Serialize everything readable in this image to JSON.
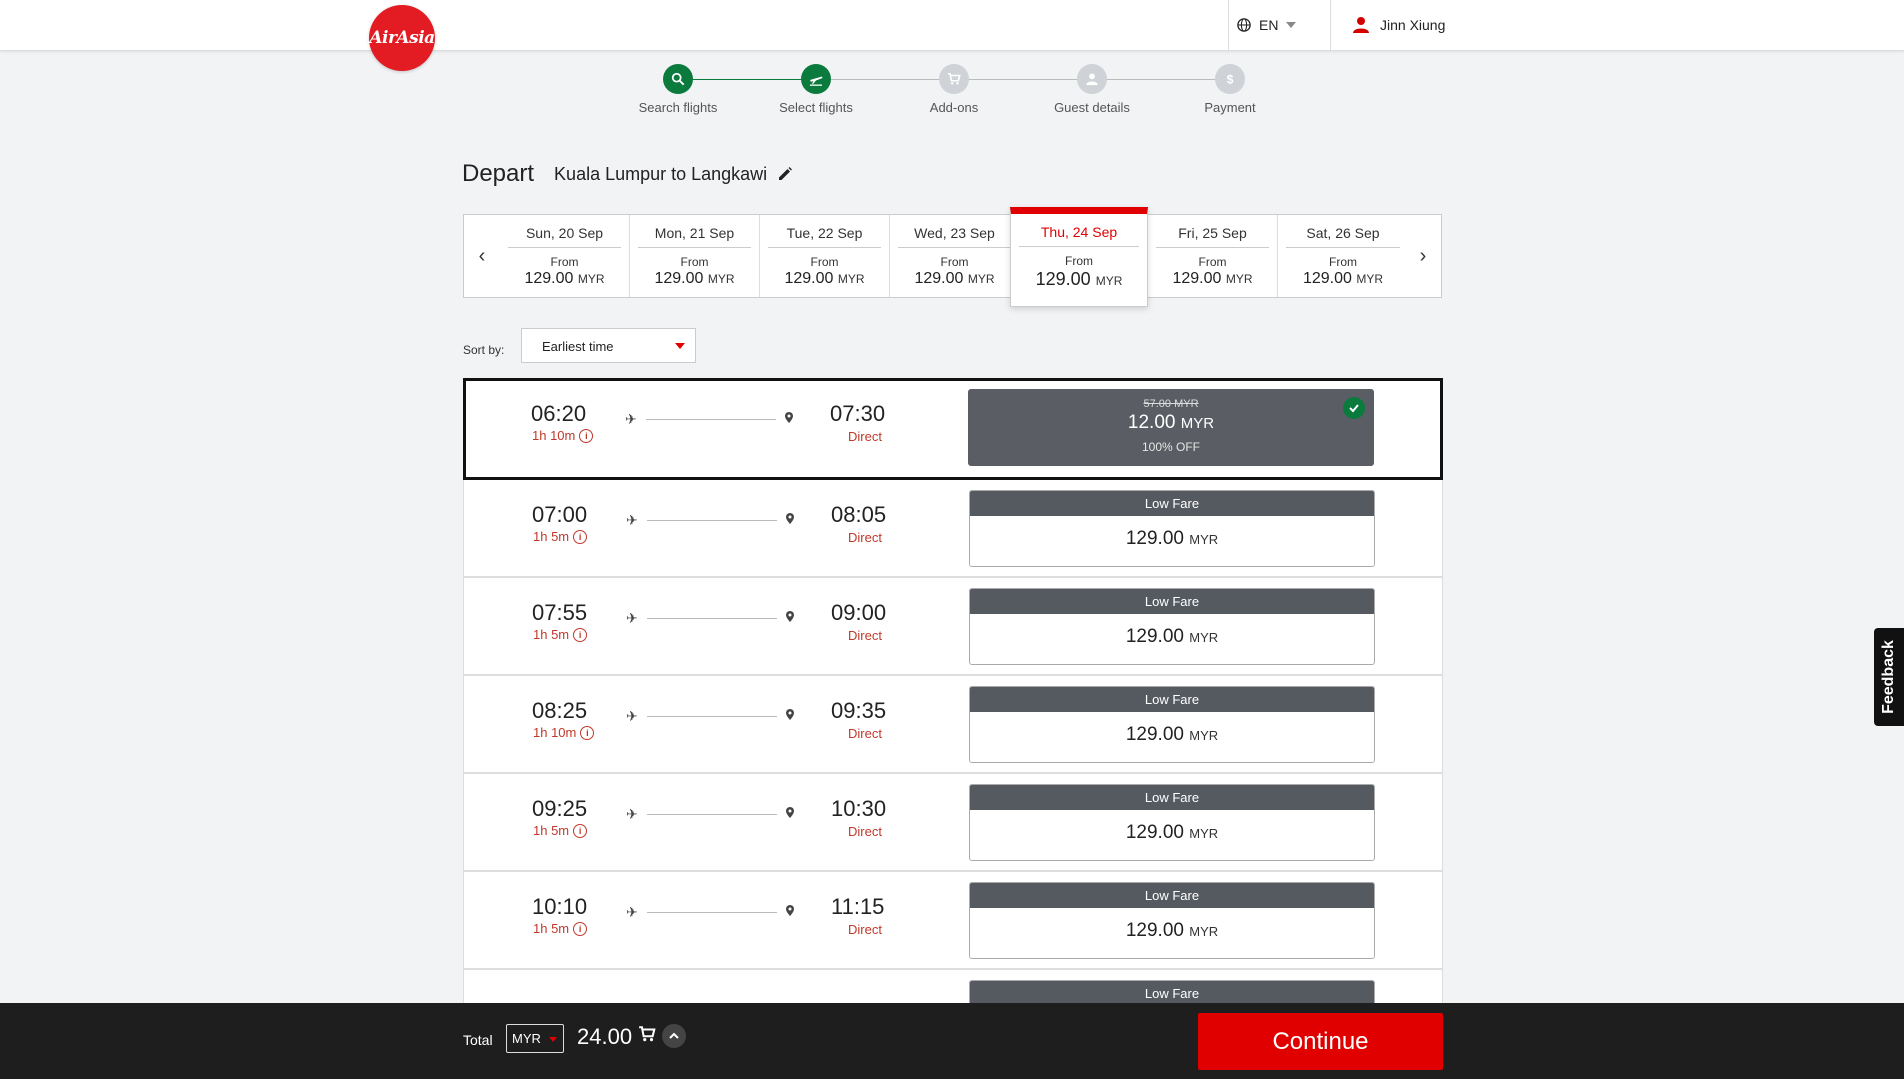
{
  "header": {
    "logo_text": "AirAsia",
    "language": "EN",
    "user_name": "Jinn Xiung"
  },
  "steps": [
    {
      "label": "Search flights",
      "icon": "search-icon",
      "state": "done"
    },
    {
      "label": "Select flights",
      "icon": "plane-icon",
      "state": "active"
    },
    {
      "label": "Add-ons",
      "icon": "cart-icon",
      "state": "pending"
    },
    {
      "label": "Guest details",
      "icon": "person-icon",
      "state": "pending"
    },
    {
      "label": "Payment",
      "icon": "dollar-icon",
      "state": "pending"
    }
  ],
  "depart": {
    "title": "Depart",
    "route": "Kuala Lumpur to Langkawi"
  },
  "dates": [
    {
      "day": "Sun, 20 Sep",
      "from": "From",
      "price": "129.00",
      "currency": "MYR"
    },
    {
      "day": "Mon, 21 Sep",
      "from": "From",
      "price": "129.00",
      "currency": "MYR"
    },
    {
      "day": "Tue, 22 Sep",
      "from": "From",
      "price": "129.00",
      "currency": "MYR"
    },
    {
      "day": "Wed, 23 Sep",
      "from": "From",
      "price": "129.00",
      "currency": "MYR"
    },
    {
      "day": "Thu, 24 Sep",
      "from": "From",
      "price": "129.00",
      "currency": "MYR",
      "selected": true
    },
    {
      "day": "Fri, 25 Sep",
      "from": "From",
      "price": "129.00",
      "currency": "MYR"
    },
    {
      "day": "Sat, 26 Sep",
      "from": "From",
      "price": "129.00",
      "currency": "MYR"
    }
  ],
  "sort": {
    "label": "Sort by:",
    "value": "Earliest time"
  },
  "flights": [
    {
      "dep": "06:20",
      "dur": "1h 10m",
      "arr": "07:30",
      "stops": "Direct",
      "promo": true,
      "old_price": "57.00 MYR",
      "price": "12.00",
      "currency": "MYR",
      "discount": "100% OFF"
    },
    {
      "dep": "07:00",
      "dur": "1h 5m",
      "arr": "08:05",
      "stops": "Direct",
      "fare_label": "Low Fare",
      "price": "129.00",
      "currency": "MYR"
    },
    {
      "dep": "07:55",
      "dur": "1h 5m",
      "arr": "09:00",
      "stops": "Direct",
      "fare_label": "Low Fare",
      "price": "129.00",
      "currency": "MYR"
    },
    {
      "dep": "08:25",
      "dur": "1h 10m",
      "arr": "09:35",
      "stops": "Direct",
      "fare_label": "Low Fare",
      "price": "129.00",
      "currency": "MYR"
    },
    {
      "dep": "09:25",
      "dur": "1h 5m",
      "arr": "10:30",
      "stops": "Direct",
      "fare_label": "Low Fare",
      "price": "129.00",
      "currency": "MYR"
    },
    {
      "dep": "10:10",
      "dur": "1h 5m",
      "arr": "11:15",
      "stops": "Direct",
      "fare_label": "Low Fare",
      "price": "129.00",
      "currency": "MYR"
    },
    {
      "dep": "",
      "dur": "",
      "arr": "",
      "stops": "",
      "fare_label": "Low Fare",
      "price": "",
      "currency": ""
    }
  ],
  "feedback": "Feedback",
  "footer": {
    "total_label": "Total",
    "currency": "MYR",
    "amount": "24.00",
    "continue_label": "Continue"
  },
  "colors": {
    "brand_red": "#e00000",
    "success_green": "#0b7a3d",
    "fare_header": "#555a61"
  }
}
